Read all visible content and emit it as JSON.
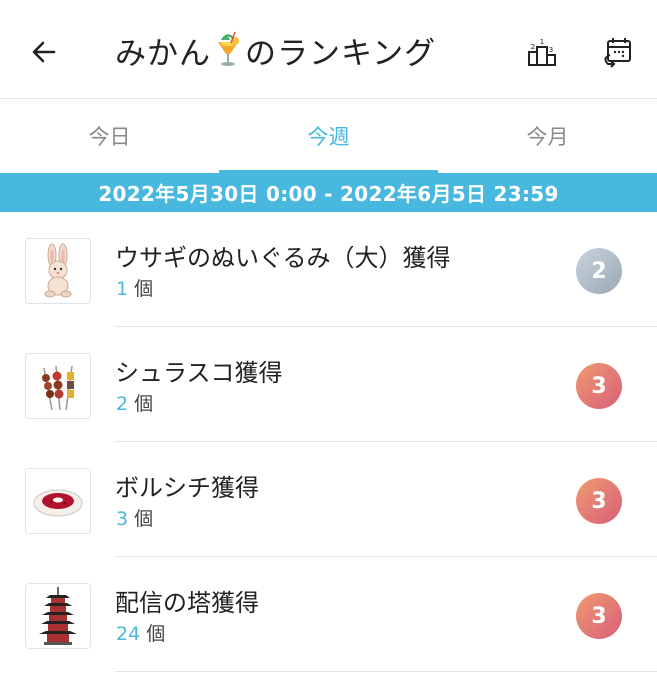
{
  "header": {
    "title_before": "みかん",
    "title_after": "のランキング",
    "back_icon": "arrow-left-icon",
    "ranking_icon": "podium-icon",
    "calendar_icon": "calendar-icon"
  },
  "tabs": [
    {
      "label": "今日",
      "active": false
    },
    {
      "label": "今週",
      "active": true
    },
    {
      "label": "今月",
      "active": false
    }
  ],
  "date_range": "2022年5月30日 0:00 - 2022年6月5日 23:59",
  "items": [
    {
      "name": "ウサギのぬいぐるみ（大）獲得",
      "count": "1",
      "unit": "個",
      "rank": "2",
      "rank_color": "silver",
      "icon": "rabbit-plush-icon"
    },
    {
      "name": "シュラスコ獲得",
      "count": "2",
      "unit": "個",
      "rank": "3",
      "rank_color": "bronze",
      "icon": "skewers-icon"
    },
    {
      "name": "ボルシチ獲得",
      "count": "3",
      "unit": "個",
      "rank": "3",
      "rank_color": "bronze",
      "icon": "borscht-icon"
    },
    {
      "name": "配信の塔獲得",
      "count": "24",
      "unit": "個",
      "rank": "3",
      "rank_color": "bronze",
      "icon": "pagoda-tower-icon"
    }
  ],
  "colors": {
    "accent": "#49b8df",
    "silver_badge": "#aab7c3",
    "bronze_badge": "#e07a74"
  }
}
